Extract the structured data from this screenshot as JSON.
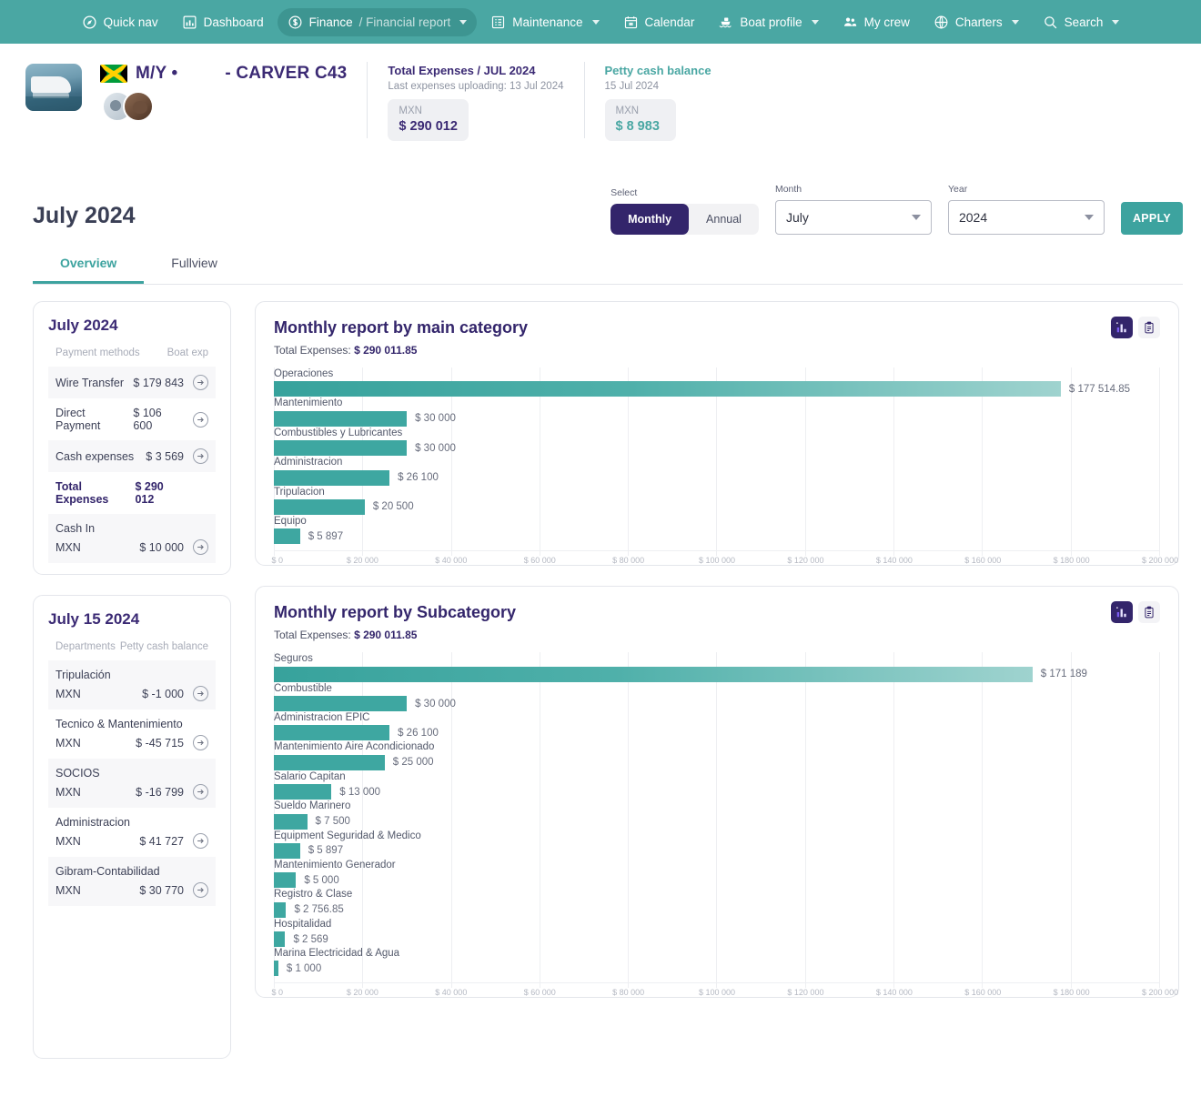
{
  "nav": {
    "items": [
      {
        "label": "Quick nav",
        "icon": "compass-icon",
        "caret": false,
        "active": false
      },
      {
        "label": "Dashboard",
        "icon": "dashboard-icon",
        "caret": false,
        "active": false
      },
      {
        "label": "Finance",
        "sublabel": "/ Financial report",
        "icon": "dollar-icon",
        "caret": true,
        "active": true
      },
      {
        "label": "Maintenance",
        "icon": "list-icon",
        "caret": true,
        "active": false
      },
      {
        "label": "Calendar",
        "icon": "calendar-icon",
        "caret": false,
        "active": false
      },
      {
        "label": "Boat profile",
        "icon": "boat-icon",
        "caret": true,
        "active": false
      },
      {
        "label": "My crew",
        "icon": "crew-icon",
        "caret": false,
        "active": false
      },
      {
        "label": "Charters",
        "icon": "globe-icon",
        "caret": true,
        "active": false
      },
      {
        "label": "Search",
        "icon": "search-icon",
        "caret": true,
        "active": false
      }
    ]
  },
  "boat": {
    "name_prefix": "M/Y •",
    "name_suffix": "- CARVER C43",
    "flag": "jamaica-flag"
  },
  "kpis": {
    "total_expenses": {
      "title": "Total Expenses / JUL 2024",
      "sub": "Last expenses uploading: 13 Jul 2024",
      "currency": "MXN",
      "value": "$  290 012"
    },
    "petty_cash": {
      "title": "Petty cash balance",
      "sub": "15 Jul 2024",
      "currency": "MXN",
      "value": "$  8 983"
    }
  },
  "page": {
    "title": "July 2024"
  },
  "filters": {
    "select_label": "Select",
    "monthly_label": "Monthly",
    "annual_label": "Annual",
    "month_label": "Month",
    "month_value": "July",
    "year_label": "Year",
    "year_value": "2024",
    "apply_label": "APPLY"
  },
  "tabs": [
    {
      "label": "Overview",
      "active": true
    },
    {
      "label": "Fullview",
      "active": false
    }
  ],
  "summary_card": {
    "title": "July 2024",
    "col1": "Payment methods",
    "col2": "Boat exp",
    "rows": [
      {
        "label": "Wire Transfer",
        "value": "$ 179 843",
        "arrow": true,
        "bold": false,
        "alt": true
      },
      {
        "label": "Direct Payment",
        "value": "$ 106 600",
        "arrow": true,
        "bold": false,
        "alt": false
      },
      {
        "label": "Cash expenses",
        "value": "$ 3 569",
        "arrow": true,
        "bold": false,
        "alt": true
      },
      {
        "label": "Total Expenses",
        "value": "$ 290 012",
        "arrow": false,
        "bold": true,
        "alt": false
      }
    ],
    "cash_in": {
      "label": "Cash In",
      "currency": "MXN",
      "value": "$ 10 000"
    }
  },
  "departments_card": {
    "title": "July 15 2024",
    "col1": "Departments",
    "col2": "Petty cash balance",
    "rows": [
      {
        "name": "Tripulación",
        "currency": "MXN",
        "value": "$ -1 000",
        "alt": true
      },
      {
        "name": "Tecnico & Mantenimiento",
        "currency": "MXN",
        "value": "$ -45 715",
        "alt": false
      },
      {
        "name": "SOCIOS",
        "currency": "MXN",
        "value": "$ -16 799",
        "alt": true
      },
      {
        "name": "Administracion",
        "currency": "MXN",
        "value": "$ 41 727",
        "alt": false
      },
      {
        "name": "Gibram-Contabilidad",
        "currency": "MXN",
        "value": "$ 30 770",
        "alt": true
      }
    ]
  },
  "chart_data": [
    {
      "type": "bar",
      "orientation": "horizontal",
      "title": "Monthly report by main category",
      "subtitle_prefix": "Total Expenses: ",
      "subtitle_value": "$ 290 011.85",
      "xlabel": "",
      "ylabel": "",
      "xlim": [
        0,
        200000
      ],
      "grid": true,
      "xticks": [
        "$ 0",
        "$ 20 000",
        "$ 40 000",
        "$ 60 000",
        "$ 80 000",
        "$ 100 000",
        "$ 120 000",
        "$ 140 000",
        "$ 160 000",
        "$ 180 000",
        "$ 200 000"
      ],
      "categories": [
        "Operaciones",
        "Mantenimiento",
        "Combustibles y Lubricantes",
        "Administracion",
        "Tripulacion",
        "Equipo"
      ],
      "values": [
        177514.85,
        30000,
        30000,
        26100,
        20500,
        5897
      ],
      "labels": [
        "$ 177 514.85",
        "$ 30 000",
        "$ 30 000",
        "$ 26 100",
        "$ 20 500",
        "$ 5 897"
      ],
      "tools": {
        "chart_icon": "bar-chart-icon",
        "table_icon": "clipboard-icon",
        "active": "chart"
      }
    },
    {
      "type": "bar",
      "orientation": "horizontal",
      "title": "Monthly report by Subcategory",
      "subtitle_prefix": "Total Expenses: ",
      "subtitle_value": "$ 290 011.85",
      "xlabel": "",
      "ylabel": "",
      "xlim": [
        0,
        200000
      ],
      "grid": true,
      "xticks": [
        "$ 0",
        "$ 20 000",
        "$ 40 000",
        "$ 60 000",
        "$ 80 000",
        "$ 100 000",
        "$ 120 000",
        "$ 140 000",
        "$ 160 000",
        "$ 180 000",
        "$ 200 000"
      ],
      "categories": [
        "Seguros",
        "Combustible",
        "Administracion EPIC",
        "Mantenimiento Aire Acondicionado",
        "Salario Capitan",
        "Sueldo Marinero",
        "Equipment Seguridad & Medico",
        "Mantenimiento Generador",
        "Registro & Clase",
        "Hospitalidad",
        "Marina Electricidad & Agua"
      ],
      "values": [
        171189,
        30000,
        26100,
        25000,
        13000,
        7500,
        5897,
        5000,
        2756.85,
        2569,
        1000
      ],
      "labels": [
        "$ 171 189",
        "$ 30 000",
        "$ 26 100",
        "$ 25 000",
        "$ 13 000",
        "$ 7 500",
        "$ 5 897",
        "$ 5 000",
        "$ 2 756.85",
        "$ 2 569",
        "$ 1 000"
      ],
      "tools": {
        "chart_icon": "bar-chart-icon",
        "table_icon": "clipboard-icon",
        "active": "chart"
      }
    }
  ],
  "colors": {
    "teal": "#4aa7a3",
    "purple": "#33256b",
    "bar": "#3ea7a1"
  }
}
